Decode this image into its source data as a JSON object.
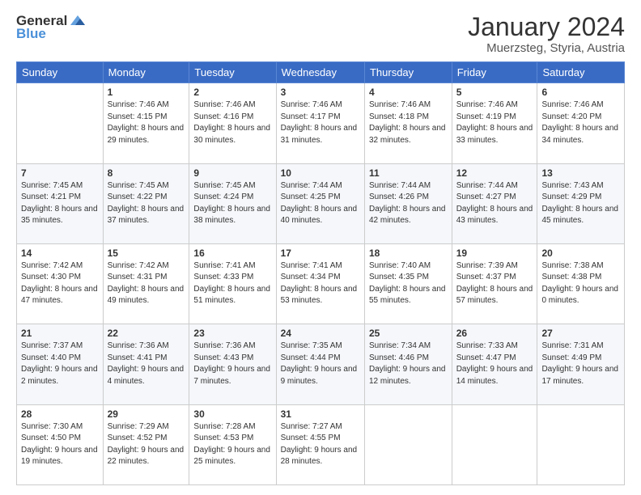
{
  "logo": {
    "general": "General",
    "blue": "Blue"
  },
  "header": {
    "title": "January 2024",
    "subtitle": "Muerzsteg, Styria, Austria"
  },
  "weekdays": [
    "Sunday",
    "Monday",
    "Tuesday",
    "Wednesday",
    "Thursday",
    "Friday",
    "Saturday"
  ],
  "weeks": [
    [
      {
        "day": "",
        "sunrise": "",
        "sunset": "",
        "daylight": ""
      },
      {
        "day": "1",
        "sunrise": "Sunrise: 7:46 AM",
        "sunset": "Sunset: 4:15 PM",
        "daylight": "Daylight: 8 hours and 29 minutes."
      },
      {
        "day": "2",
        "sunrise": "Sunrise: 7:46 AM",
        "sunset": "Sunset: 4:16 PM",
        "daylight": "Daylight: 8 hours and 30 minutes."
      },
      {
        "day": "3",
        "sunrise": "Sunrise: 7:46 AM",
        "sunset": "Sunset: 4:17 PM",
        "daylight": "Daylight: 8 hours and 31 minutes."
      },
      {
        "day": "4",
        "sunrise": "Sunrise: 7:46 AM",
        "sunset": "Sunset: 4:18 PM",
        "daylight": "Daylight: 8 hours and 32 minutes."
      },
      {
        "day": "5",
        "sunrise": "Sunrise: 7:46 AM",
        "sunset": "Sunset: 4:19 PM",
        "daylight": "Daylight: 8 hours and 33 minutes."
      },
      {
        "day": "6",
        "sunrise": "Sunrise: 7:46 AM",
        "sunset": "Sunset: 4:20 PM",
        "daylight": "Daylight: 8 hours and 34 minutes."
      }
    ],
    [
      {
        "day": "7",
        "sunrise": "Sunrise: 7:45 AM",
        "sunset": "Sunset: 4:21 PM",
        "daylight": "Daylight: 8 hours and 35 minutes."
      },
      {
        "day": "8",
        "sunrise": "Sunrise: 7:45 AM",
        "sunset": "Sunset: 4:22 PM",
        "daylight": "Daylight: 8 hours and 37 minutes."
      },
      {
        "day": "9",
        "sunrise": "Sunrise: 7:45 AM",
        "sunset": "Sunset: 4:24 PM",
        "daylight": "Daylight: 8 hours and 38 minutes."
      },
      {
        "day": "10",
        "sunrise": "Sunrise: 7:44 AM",
        "sunset": "Sunset: 4:25 PM",
        "daylight": "Daylight: 8 hours and 40 minutes."
      },
      {
        "day": "11",
        "sunrise": "Sunrise: 7:44 AM",
        "sunset": "Sunset: 4:26 PM",
        "daylight": "Daylight: 8 hours and 42 minutes."
      },
      {
        "day": "12",
        "sunrise": "Sunrise: 7:44 AM",
        "sunset": "Sunset: 4:27 PM",
        "daylight": "Daylight: 8 hours and 43 minutes."
      },
      {
        "day": "13",
        "sunrise": "Sunrise: 7:43 AM",
        "sunset": "Sunset: 4:29 PM",
        "daylight": "Daylight: 8 hours and 45 minutes."
      }
    ],
    [
      {
        "day": "14",
        "sunrise": "Sunrise: 7:42 AM",
        "sunset": "Sunset: 4:30 PM",
        "daylight": "Daylight: 8 hours and 47 minutes."
      },
      {
        "day": "15",
        "sunrise": "Sunrise: 7:42 AM",
        "sunset": "Sunset: 4:31 PM",
        "daylight": "Daylight: 8 hours and 49 minutes."
      },
      {
        "day": "16",
        "sunrise": "Sunrise: 7:41 AM",
        "sunset": "Sunset: 4:33 PM",
        "daylight": "Daylight: 8 hours and 51 minutes."
      },
      {
        "day": "17",
        "sunrise": "Sunrise: 7:41 AM",
        "sunset": "Sunset: 4:34 PM",
        "daylight": "Daylight: 8 hours and 53 minutes."
      },
      {
        "day": "18",
        "sunrise": "Sunrise: 7:40 AM",
        "sunset": "Sunset: 4:35 PM",
        "daylight": "Daylight: 8 hours and 55 minutes."
      },
      {
        "day": "19",
        "sunrise": "Sunrise: 7:39 AM",
        "sunset": "Sunset: 4:37 PM",
        "daylight": "Daylight: 8 hours and 57 minutes."
      },
      {
        "day": "20",
        "sunrise": "Sunrise: 7:38 AM",
        "sunset": "Sunset: 4:38 PM",
        "daylight": "Daylight: 9 hours and 0 minutes."
      }
    ],
    [
      {
        "day": "21",
        "sunrise": "Sunrise: 7:37 AM",
        "sunset": "Sunset: 4:40 PM",
        "daylight": "Daylight: 9 hours and 2 minutes."
      },
      {
        "day": "22",
        "sunrise": "Sunrise: 7:36 AM",
        "sunset": "Sunset: 4:41 PM",
        "daylight": "Daylight: 9 hours and 4 minutes."
      },
      {
        "day": "23",
        "sunrise": "Sunrise: 7:36 AM",
        "sunset": "Sunset: 4:43 PM",
        "daylight": "Daylight: 9 hours and 7 minutes."
      },
      {
        "day": "24",
        "sunrise": "Sunrise: 7:35 AM",
        "sunset": "Sunset: 4:44 PM",
        "daylight": "Daylight: 9 hours and 9 minutes."
      },
      {
        "day": "25",
        "sunrise": "Sunrise: 7:34 AM",
        "sunset": "Sunset: 4:46 PM",
        "daylight": "Daylight: 9 hours and 12 minutes."
      },
      {
        "day": "26",
        "sunrise": "Sunrise: 7:33 AM",
        "sunset": "Sunset: 4:47 PM",
        "daylight": "Daylight: 9 hours and 14 minutes."
      },
      {
        "day": "27",
        "sunrise": "Sunrise: 7:31 AM",
        "sunset": "Sunset: 4:49 PM",
        "daylight": "Daylight: 9 hours and 17 minutes."
      }
    ],
    [
      {
        "day": "28",
        "sunrise": "Sunrise: 7:30 AM",
        "sunset": "Sunset: 4:50 PM",
        "daylight": "Daylight: 9 hours and 19 minutes."
      },
      {
        "day": "29",
        "sunrise": "Sunrise: 7:29 AM",
        "sunset": "Sunset: 4:52 PM",
        "daylight": "Daylight: 9 hours and 22 minutes."
      },
      {
        "day": "30",
        "sunrise": "Sunrise: 7:28 AM",
        "sunset": "Sunset: 4:53 PM",
        "daylight": "Daylight: 9 hours and 25 minutes."
      },
      {
        "day": "31",
        "sunrise": "Sunrise: 7:27 AM",
        "sunset": "Sunset: 4:55 PM",
        "daylight": "Daylight: 9 hours and 28 minutes."
      },
      {
        "day": "",
        "sunrise": "",
        "sunset": "",
        "daylight": ""
      },
      {
        "day": "",
        "sunrise": "",
        "sunset": "",
        "daylight": ""
      },
      {
        "day": "",
        "sunrise": "",
        "sunset": "",
        "daylight": ""
      }
    ]
  ]
}
